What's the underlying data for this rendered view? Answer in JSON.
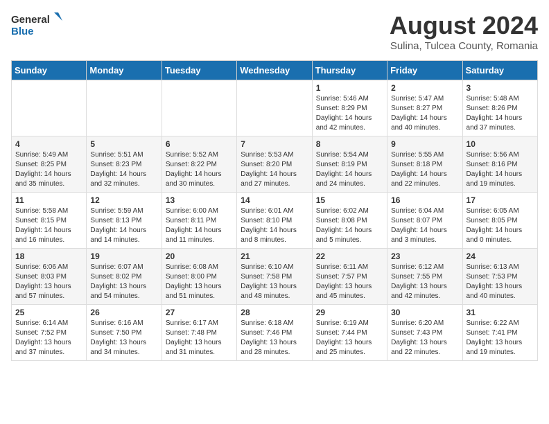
{
  "header": {
    "logo_general": "General",
    "logo_blue": "Blue",
    "month_year": "August 2024",
    "location": "Sulina, Tulcea County, Romania"
  },
  "calendar": {
    "days_of_week": [
      "Sunday",
      "Monday",
      "Tuesday",
      "Wednesday",
      "Thursday",
      "Friday",
      "Saturday"
    ],
    "weeks": [
      [
        {
          "day": "",
          "info": ""
        },
        {
          "day": "",
          "info": ""
        },
        {
          "day": "",
          "info": ""
        },
        {
          "day": "",
          "info": ""
        },
        {
          "day": "1",
          "info": "Sunrise: 5:46 AM\nSunset: 8:29 PM\nDaylight: 14 hours\nand 42 minutes."
        },
        {
          "day": "2",
          "info": "Sunrise: 5:47 AM\nSunset: 8:27 PM\nDaylight: 14 hours\nand 40 minutes."
        },
        {
          "day": "3",
          "info": "Sunrise: 5:48 AM\nSunset: 8:26 PM\nDaylight: 14 hours\nand 37 minutes."
        }
      ],
      [
        {
          "day": "4",
          "info": "Sunrise: 5:49 AM\nSunset: 8:25 PM\nDaylight: 14 hours\nand 35 minutes."
        },
        {
          "day": "5",
          "info": "Sunrise: 5:51 AM\nSunset: 8:23 PM\nDaylight: 14 hours\nand 32 minutes."
        },
        {
          "day": "6",
          "info": "Sunrise: 5:52 AM\nSunset: 8:22 PM\nDaylight: 14 hours\nand 30 minutes."
        },
        {
          "day": "7",
          "info": "Sunrise: 5:53 AM\nSunset: 8:20 PM\nDaylight: 14 hours\nand 27 minutes."
        },
        {
          "day": "8",
          "info": "Sunrise: 5:54 AM\nSunset: 8:19 PM\nDaylight: 14 hours\nand 24 minutes."
        },
        {
          "day": "9",
          "info": "Sunrise: 5:55 AM\nSunset: 8:18 PM\nDaylight: 14 hours\nand 22 minutes."
        },
        {
          "day": "10",
          "info": "Sunrise: 5:56 AM\nSunset: 8:16 PM\nDaylight: 14 hours\nand 19 minutes."
        }
      ],
      [
        {
          "day": "11",
          "info": "Sunrise: 5:58 AM\nSunset: 8:15 PM\nDaylight: 14 hours\nand 16 minutes."
        },
        {
          "day": "12",
          "info": "Sunrise: 5:59 AM\nSunset: 8:13 PM\nDaylight: 14 hours\nand 14 minutes."
        },
        {
          "day": "13",
          "info": "Sunrise: 6:00 AM\nSunset: 8:11 PM\nDaylight: 14 hours\nand 11 minutes."
        },
        {
          "day": "14",
          "info": "Sunrise: 6:01 AM\nSunset: 8:10 PM\nDaylight: 14 hours\nand 8 minutes."
        },
        {
          "day": "15",
          "info": "Sunrise: 6:02 AM\nSunset: 8:08 PM\nDaylight: 14 hours\nand 5 minutes."
        },
        {
          "day": "16",
          "info": "Sunrise: 6:04 AM\nSunset: 8:07 PM\nDaylight: 14 hours\nand 3 minutes."
        },
        {
          "day": "17",
          "info": "Sunrise: 6:05 AM\nSunset: 8:05 PM\nDaylight: 14 hours\nand 0 minutes."
        }
      ],
      [
        {
          "day": "18",
          "info": "Sunrise: 6:06 AM\nSunset: 8:03 PM\nDaylight: 13 hours\nand 57 minutes."
        },
        {
          "day": "19",
          "info": "Sunrise: 6:07 AM\nSunset: 8:02 PM\nDaylight: 13 hours\nand 54 minutes."
        },
        {
          "day": "20",
          "info": "Sunrise: 6:08 AM\nSunset: 8:00 PM\nDaylight: 13 hours\nand 51 minutes."
        },
        {
          "day": "21",
          "info": "Sunrise: 6:10 AM\nSunset: 7:58 PM\nDaylight: 13 hours\nand 48 minutes."
        },
        {
          "day": "22",
          "info": "Sunrise: 6:11 AM\nSunset: 7:57 PM\nDaylight: 13 hours\nand 45 minutes."
        },
        {
          "day": "23",
          "info": "Sunrise: 6:12 AM\nSunset: 7:55 PM\nDaylight: 13 hours\nand 42 minutes."
        },
        {
          "day": "24",
          "info": "Sunrise: 6:13 AM\nSunset: 7:53 PM\nDaylight: 13 hours\nand 40 minutes."
        }
      ],
      [
        {
          "day": "25",
          "info": "Sunrise: 6:14 AM\nSunset: 7:52 PM\nDaylight: 13 hours\nand 37 minutes."
        },
        {
          "day": "26",
          "info": "Sunrise: 6:16 AM\nSunset: 7:50 PM\nDaylight: 13 hours\nand 34 minutes."
        },
        {
          "day": "27",
          "info": "Sunrise: 6:17 AM\nSunset: 7:48 PM\nDaylight: 13 hours\nand 31 minutes."
        },
        {
          "day": "28",
          "info": "Sunrise: 6:18 AM\nSunset: 7:46 PM\nDaylight: 13 hours\nand 28 minutes."
        },
        {
          "day": "29",
          "info": "Sunrise: 6:19 AM\nSunset: 7:44 PM\nDaylight: 13 hours\nand 25 minutes."
        },
        {
          "day": "30",
          "info": "Sunrise: 6:20 AM\nSunset: 7:43 PM\nDaylight: 13 hours\nand 22 minutes."
        },
        {
          "day": "31",
          "info": "Sunrise: 6:22 AM\nSunset: 7:41 PM\nDaylight: 13 hours\nand 19 minutes."
        }
      ]
    ]
  }
}
